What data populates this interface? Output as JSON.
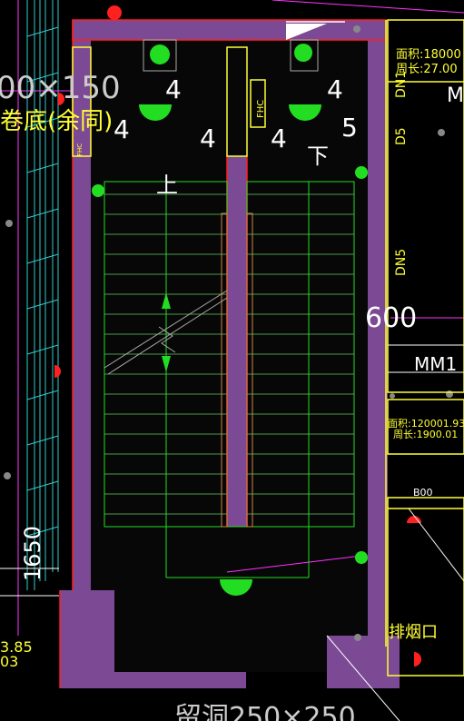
{
  "labels": {
    "dim_top_left": "00×150",
    "text_left_fragment": "卷底(余同)",
    "digit_4a": "4",
    "digit_4b": "4",
    "digit_4c": "4",
    "digit_4d": "4",
    "digit_4e": "4",
    "digit_5": "5",
    "up": "上",
    "down": "下",
    "fhc_left": "FHC",
    "fhc_right": "FHC",
    "area_top": "面积:18000",
    "perimeter_top": "周长:27.00",
    "pipe_d1": "DN1",
    "pipe_d2": "D5",
    "pipe_dn5": "DN5",
    "dim_600": "600",
    "mm1": "MM1",
    "area_mid": "面积:120001.93",
    "perimeter_mid": "周长:1900.01",
    "beam_b00": "B00",
    "dim_1650": "1650",
    "elev_a": "3.85",
    "elev_b": "03",
    "smoke_exhaust": "排烟口",
    "bottom_fragment": "留洞250×250",
    "letter_m": "M"
  },
  "colors": {
    "background": "#000000",
    "wall": "#7c4a94",
    "red_line": "#ff2020",
    "yellow": "#ffff33",
    "green": "#22dd22",
    "cyan": "#33cccc",
    "magenta": "#ff33ff",
    "white": "#ffffff",
    "gray": "#aaaaaa",
    "blue": "#3344ff"
  }
}
